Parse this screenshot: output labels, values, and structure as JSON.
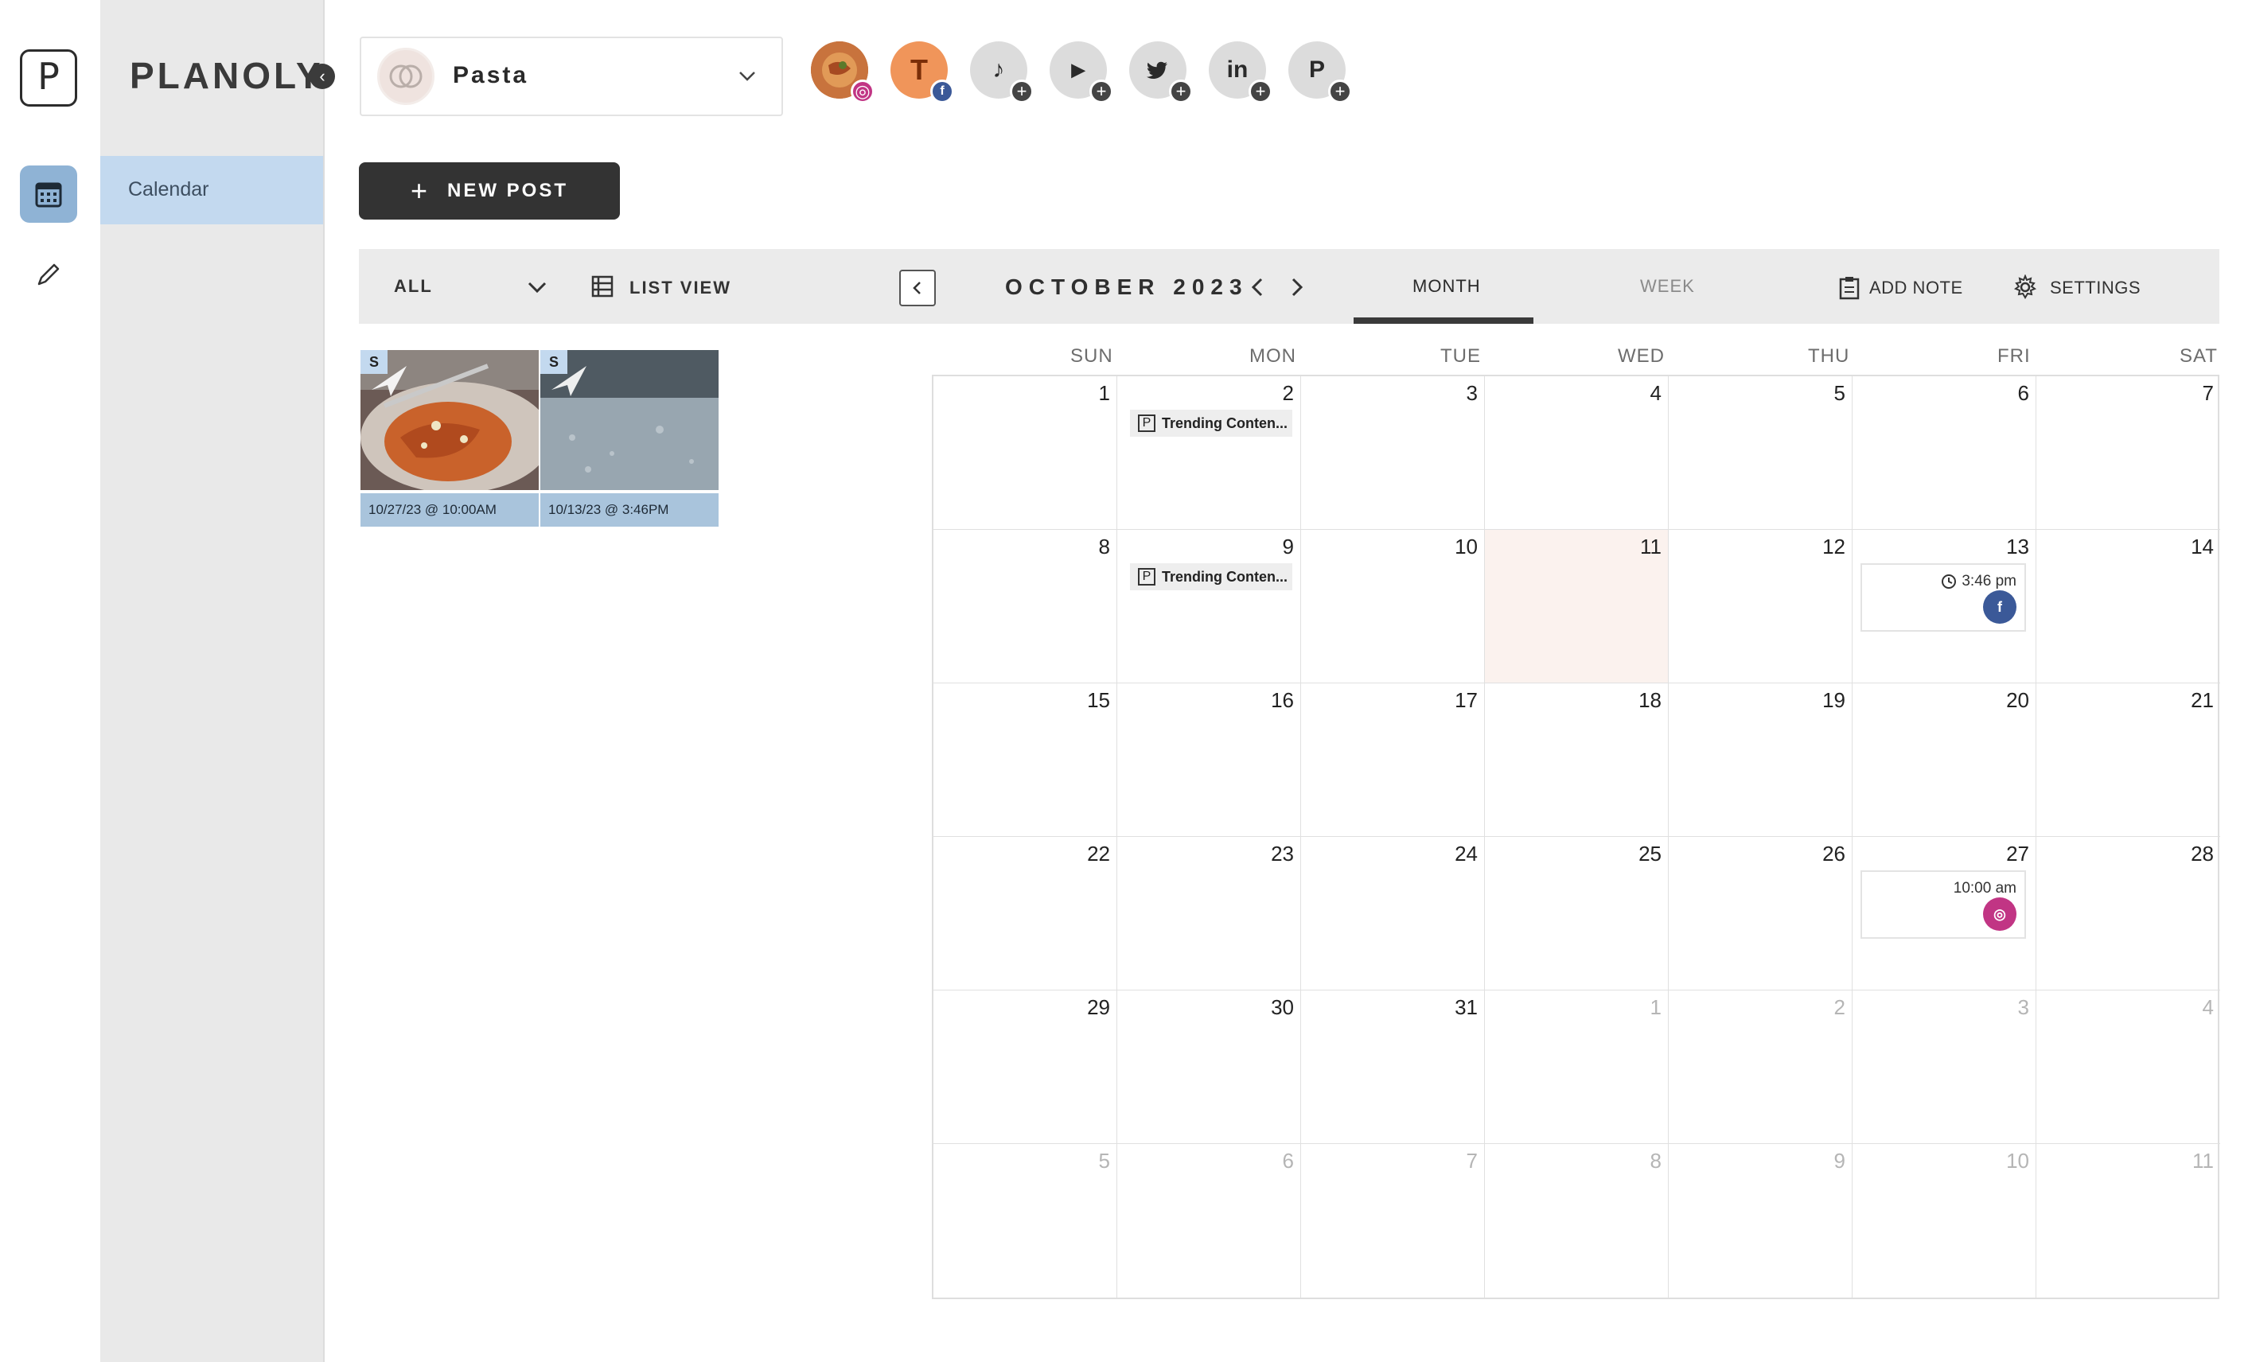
{
  "rail": {
    "logo": "P"
  },
  "sidebar": {
    "brand": "PLANOLY",
    "items": [
      {
        "label": "Calendar"
      }
    ]
  },
  "header": {
    "account": {
      "name": "Pasta"
    },
    "socials": [
      {
        "name": "instagram",
        "glyph": ""
      },
      {
        "name": "facebook",
        "glyph": "T"
      },
      {
        "name": "tiktok",
        "glyph": "♪"
      },
      {
        "name": "youtube",
        "glyph": "▶"
      },
      {
        "name": "twitter",
        "glyph": "🐦"
      },
      {
        "name": "linkedin",
        "glyph": "in"
      },
      {
        "name": "pinterest",
        "glyph": "P"
      }
    ],
    "new_post_label": "NEW POST"
  },
  "toolbar": {
    "filter": "ALL",
    "list_view": "LIST VIEW",
    "month_title": "OCTOBER 2023",
    "tab_month": "MONTH",
    "tab_week": "WEEK",
    "add_note": "ADD NOTE",
    "settings": "SETTINGS"
  },
  "unscheduled": [
    {
      "date": "10/27/23 @ 10:00AM",
      "badge": "S"
    },
    {
      "date": "10/13/23 @ 3:46PM",
      "badge": "S"
    }
  ],
  "calendar": {
    "weekdays": [
      "SUN",
      "MON",
      "TUE",
      "WED",
      "THU",
      "FRI",
      "SAT"
    ],
    "days": [
      "1",
      "2",
      "3",
      "4",
      "5",
      "6",
      "7",
      "8",
      "9",
      "10",
      "11",
      "12",
      "13",
      "14",
      "15",
      "16",
      "17",
      "18",
      "19",
      "20",
      "21",
      "22",
      "23",
      "24",
      "25",
      "26",
      "27",
      "28",
      "29",
      "30",
      "31",
      "1",
      "2",
      "3",
      "4",
      "5",
      "6",
      "7",
      "8",
      "9",
      "10",
      "11"
    ],
    "notes": {
      "text": "Trending Conten...",
      "icon": "P"
    },
    "posts": [
      {
        "time": "3:46 pm",
        "network": "facebook",
        "color": "#3b5998"
      },
      {
        "time": "10:00 am",
        "network": "instagram",
        "color": "#c13584"
      }
    ]
  },
  "colors": {
    "accent": "#8fb3d5",
    "today": "#fbf2ee",
    "caption": "#a9c4dc"
  }
}
